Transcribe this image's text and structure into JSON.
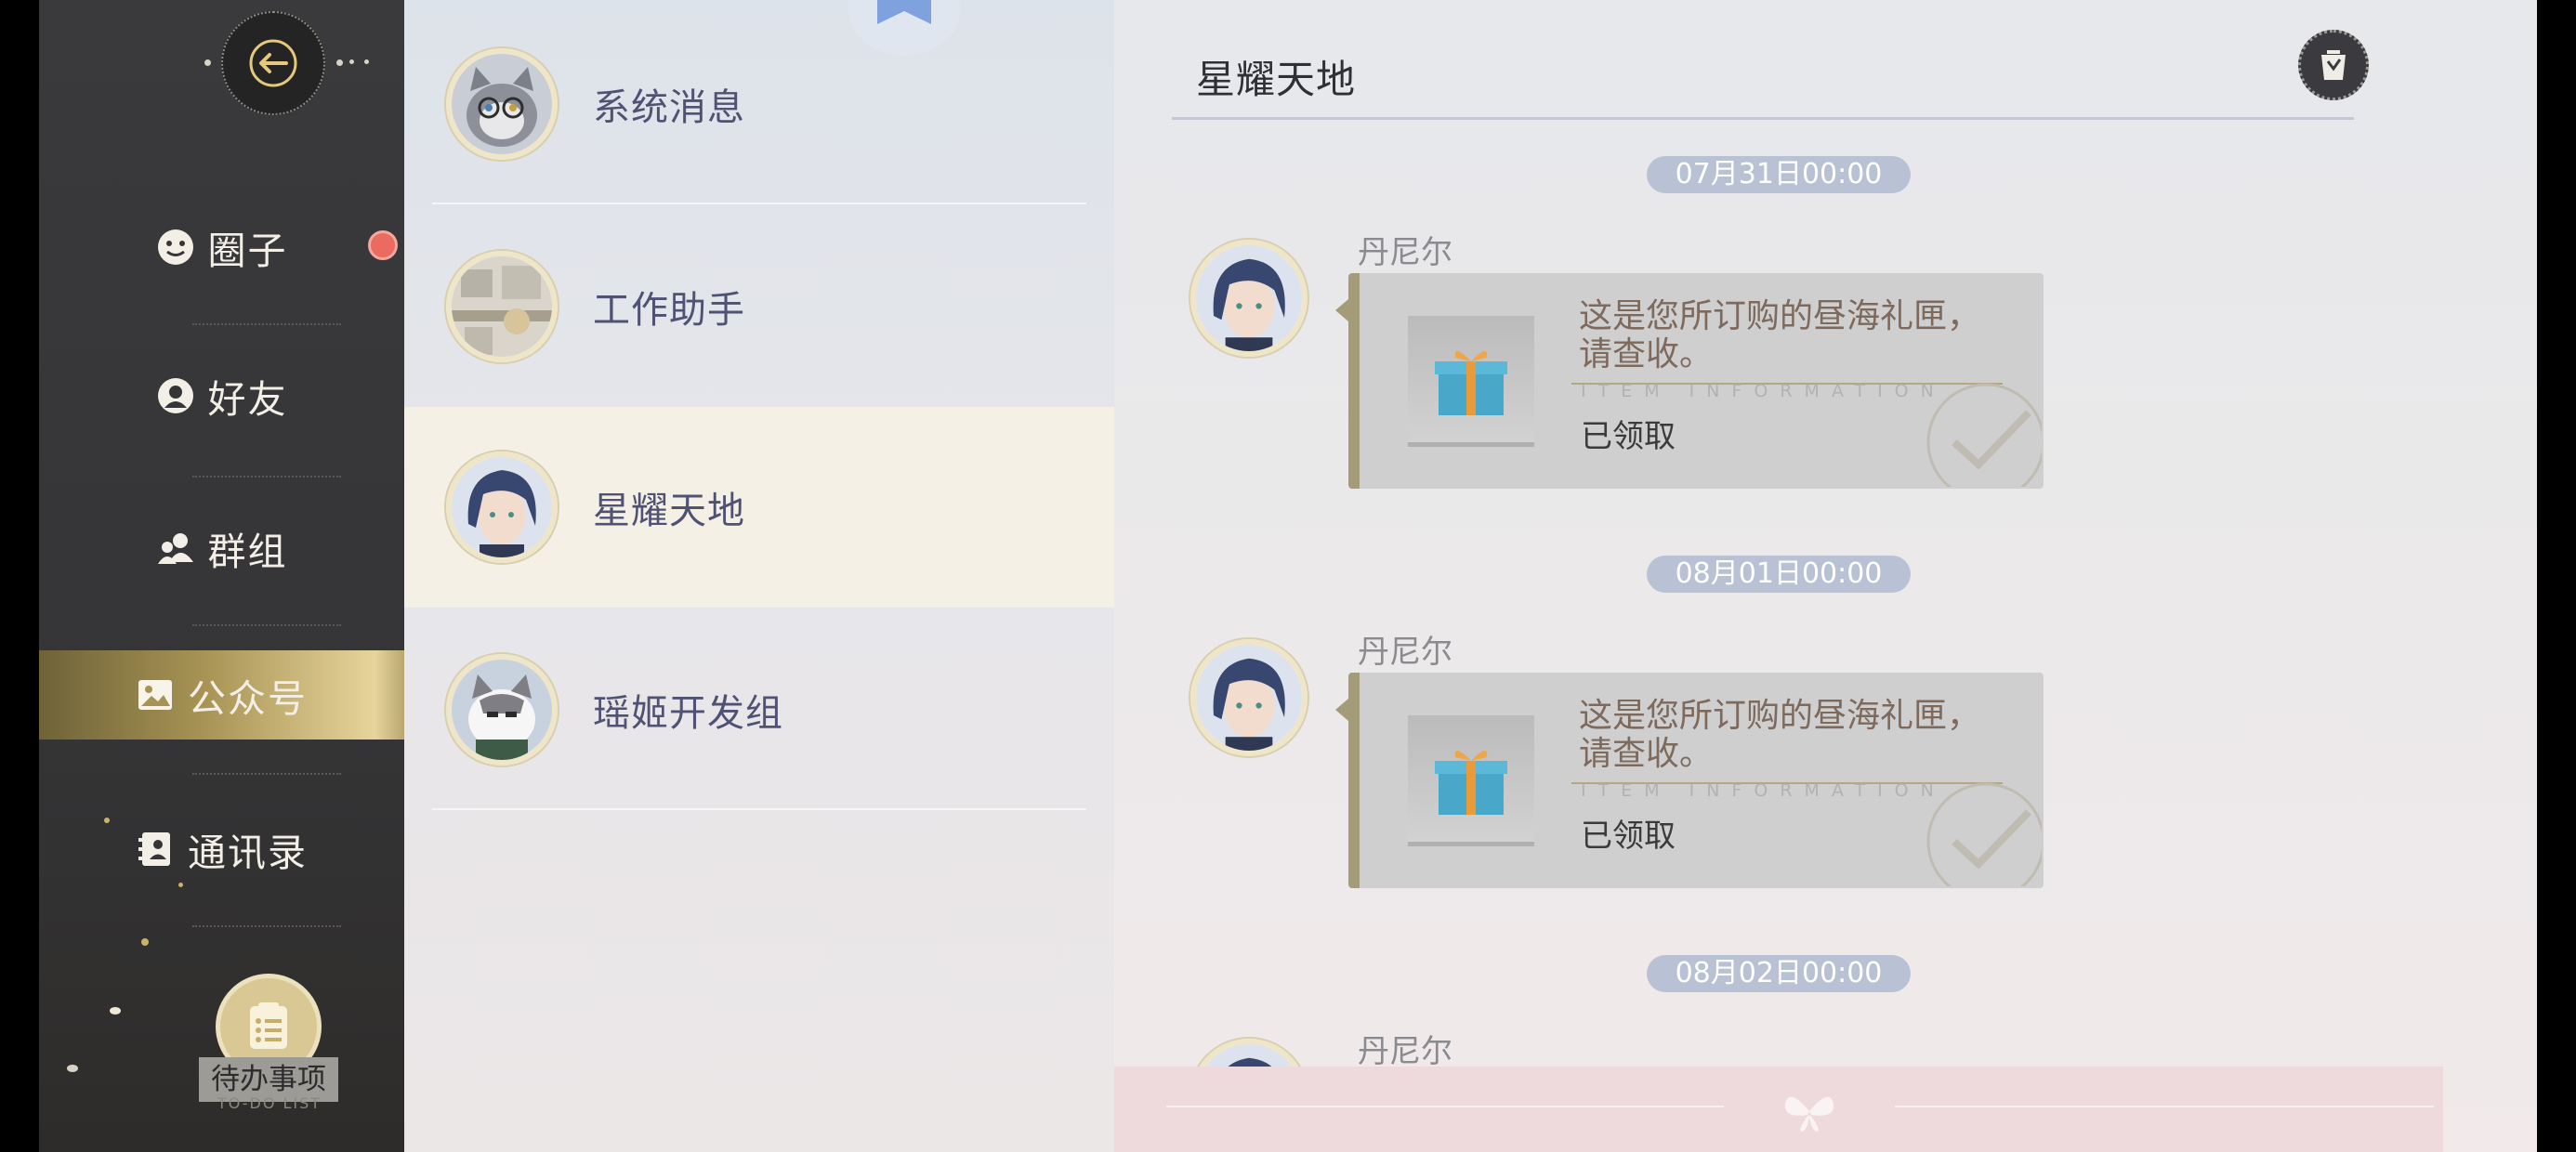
{
  "nav": {
    "items": [
      {
        "label": "圈子",
        "icon": "smile-icon"
      },
      {
        "label": "好友",
        "icon": "friend-icon"
      },
      {
        "label": "群组",
        "icon": "group-icon"
      },
      {
        "label": "公众号",
        "icon": "image-icon",
        "active": true
      },
      {
        "label": "通讯录",
        "icon": "contacts-icon"
      }
    ],
    "todo": {
      "label": "待办事项",
      "sublabel": "TO-DO LIST"
    }
  },
  "conversations": [
    {
      "name": "系统消息"
    },
    {
      "name": "工作助手"
    },
    {
      "name": "星耀天地",
      "active": true
    },
    {
      "name": "瑶姬开发组"
    }
  ],
  "chat": {
    "title": "星耀天地",
    "messages": [
      {
        "time": "07月31日00:00",
        "sender": "丹尼尔",
        "text_line1": "这是您所订购的昼海礼匣，",
        "text_line2": "请查收。",
        "info": "ITEM INFORMATION",
        "status": "已领取"
      },
      {
        "time": "08月01日00:00",
        "sender": "丹尼尔",
        "text_line1": "这是您所订购的昼海礼匣，",
        "text_line2": "请查收。",
        "info": "ITEM INFORMATION",
        "status": "已领取"
      },
      {
        "time": "08月02日00:00",
        "sender": "丹尼尔"
      }
    ]
  },
  "colors": {
    "accent_gold": "#c9b26a",
    "rail_bg": "#3a3a3c",
    "notification_red": "#ec6b61",
    "time_pill": "#b9c2d4"
  }
}
